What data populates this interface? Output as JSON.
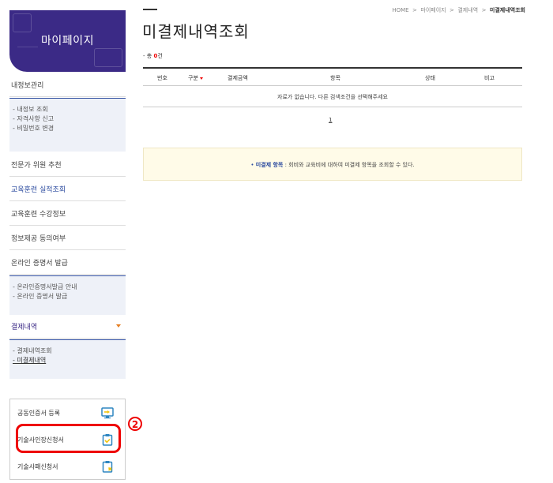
{
  "sidebar": {
    "banner_title": "마이페이지",
    "menu": [
      {
        "label": "내정보관리"
      },
      {
        "label": "전문가 위원 추천"
      },
      {
        "label": "교육훈련 실적조회"
      },
      {
        "label": "교육훈련 수강정보"
      },
      {
        "label": "정보제공 동의여부"
      },
      {
        "label": "온라인 증명서 발급"
      }
    ],
    "myinfo_sub": [
      "- 내정보 조회",
      "- 자격사항 신고",
      "- 비밀번호 변경"
    ],
    "cert_sub": [
      "- 온라인증명서발급 안내",
      "- 온라인 증명서 발급"
    ],
    "payment": {
      "label": "결제내역",
      "sub": [
        "- 결제내역조회",
        "- 미결제내역"
      ]
    },
    "cert_actions": [
      {
        "label": "공동인증서 등록",
        "icon": "certificate-monitor-icon"
      },
      {
        "label": "기술사인장신청서",
        "icon": "clipboard-check-icon"
      },
      {
        "label": "기술사패신청서",
        "icon": "clipboard-x-icon"
      }
    ],
    "annotation_number": "2"
  },
  "breadcrumb": {
    "items": [
      "HOME",
      "마이페이지",
      "결제내역"
    ],
    "separator": ">",
    "current": "미결제내역조회"
  },
  "page_title": "미결제내역조회",
  "total": {
    "prefix": "- 총",
    "count": "0",
    "suffix": "건"
  },
  "table": {
    "headers": [
      "번호",
      "구분",
      "결제금액",
      "항목",
      "상태",
      "비고"
    ],
    "empty_message": "자료가 없습니다. 다른 검색조건을 선택해주세요"
  },
  "pagination": {
    "current": "1"
  },
  "info": {
    "bullet": "•",
    "label": "미결제 항목",
    "text": ": 회비와 교육비에 대하여 미결제 항목을 조회할 수 있다."
  },
  "colors": {
    "accent": "#3b2a86",
    "link_blue": "#2e4da0",
    "highlight_red": "#ee0000",
    "info_bg": "#fffbe8"
  }
}
